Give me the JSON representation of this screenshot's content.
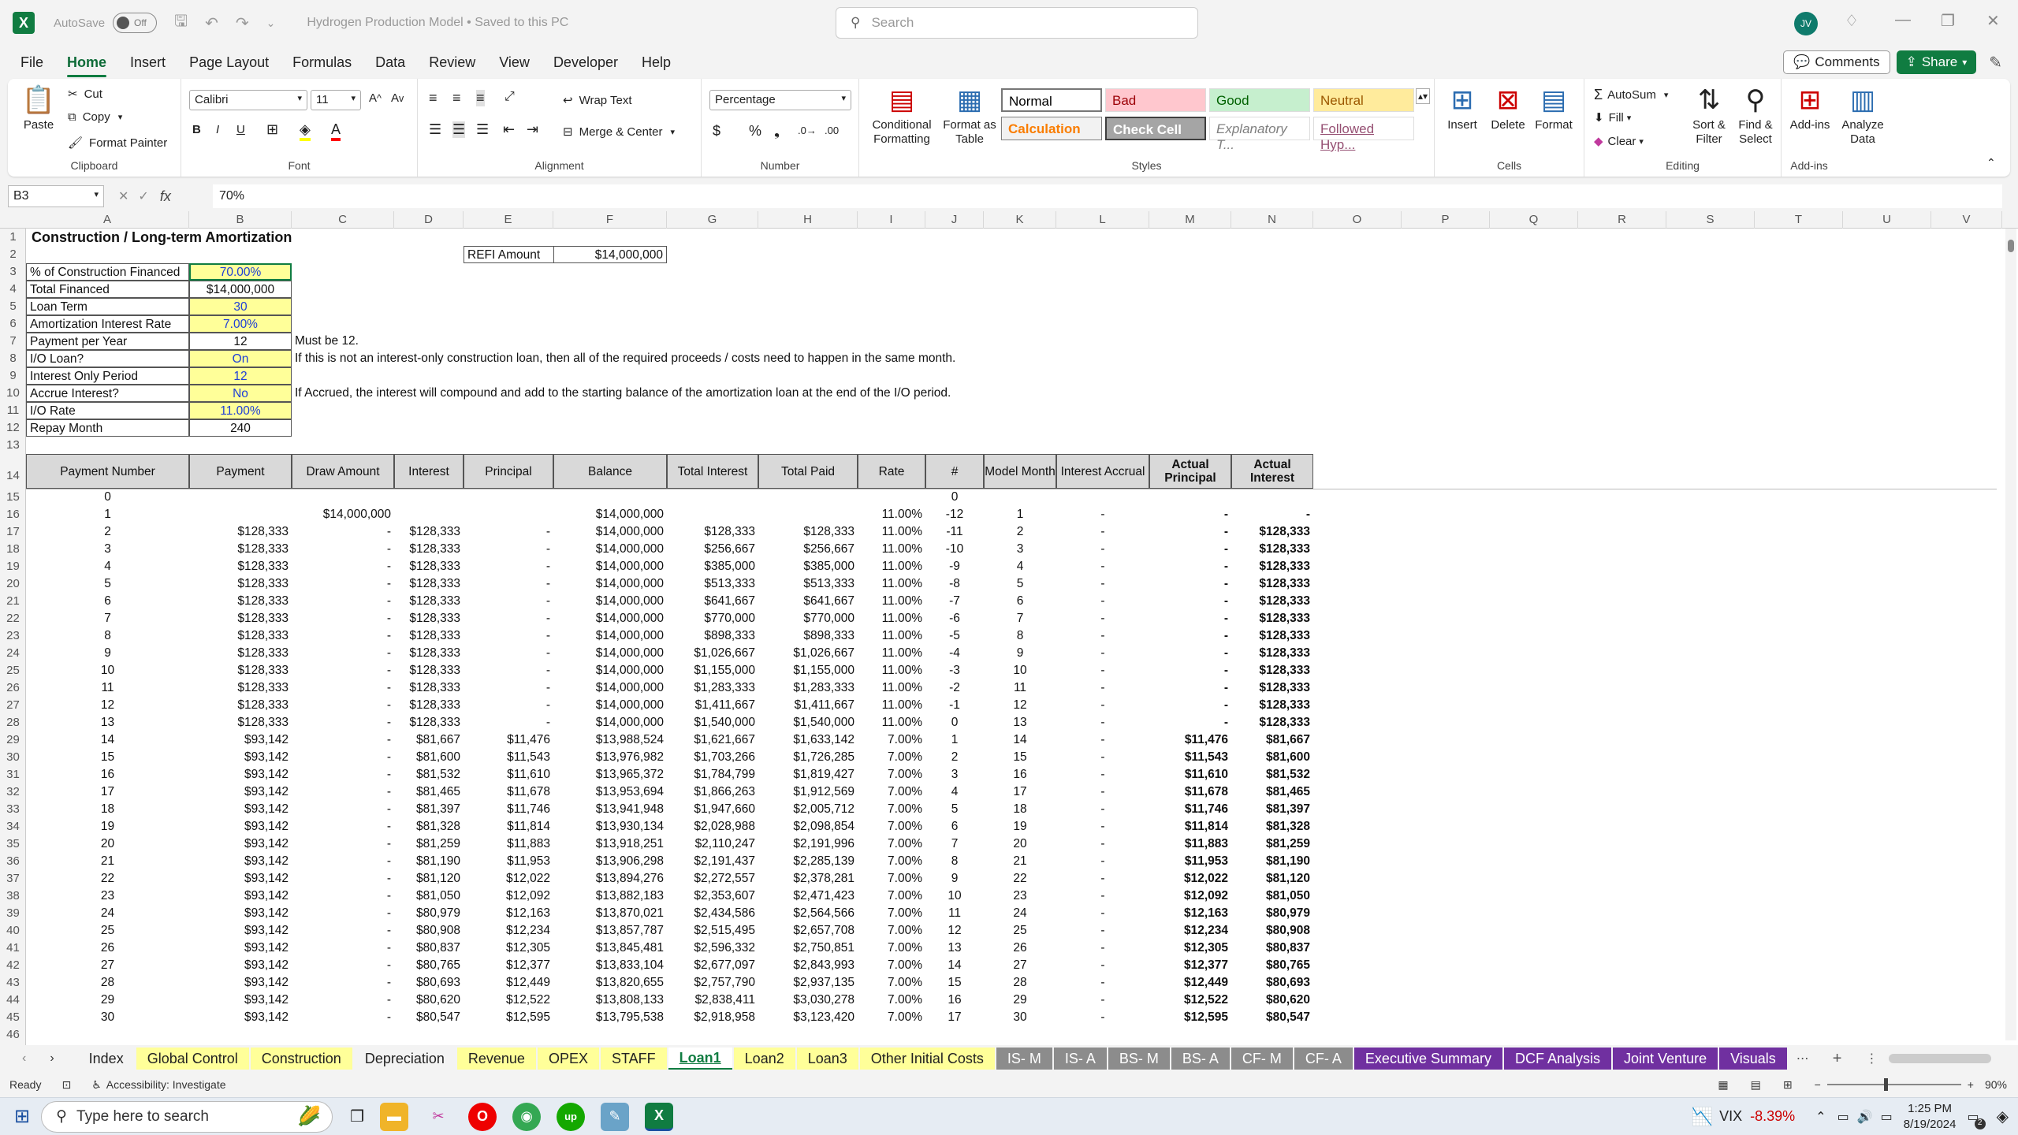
{
  "titlebar": {
    "autosave": "AutoSave",
    "autosave_state": "Off",
    "doc_title": "Hydrogen Production Model • Saved to this PC",
    "search_placeholder": "Search",
    "avatar": "JV"
  },
  "menu": [
    "File",
    "Home",
    "Insert",
    "Page Layout",
    "Formulas",
    "Data",
    "Review",
    "View",
    "Developer",
    "Help"
  ],
  "menu_active": "Home",
  "menu_right": {
    "comments": "Comments",
    "share": "Share"
  },
  "ribbon": {
    "clipboard": {
      "label": "Clipboard",
      "paste": "Paste",
      "cut": "Cut",
      "copy": "Copy",
      "format_painter": "Format Painter"
    },
    "font": {
      "label": "Font",
      "family": "Calibri",
      "size": "11"
    },
    "alignment": {
      "label": "Alignment",
      "wrap": "Wrap Text",
      "merge": "Merge & Center"
    },
    "number": {
      "label": "Number",
      "format": "Percentage"
    },
    "styles": {
      "label": "Styles",
      "conditional": "Conditional Formatting",
      "table": "Format as Table",
      "cells": [
        {
          "name": "Normal",
          "bg": "#ffffff",
          "fg": "#000000"
        },
        {
          "name": "Bad",
          "bg": "#ffc7ce",
          "fg": "#9c0006"
        },
        {
          "name": "Good",
          "bg": "#c6efce",
          "fg": "#006100"
        },
        {
          "name": "Neutral",
          "bg": "#ffeb9c",
          "fg": "#9c5700"
        },
        {
          "name": "Calculation",
          "bg": "#f2f2f2",
          "fg": "#fa7d00"
        },
        {
          "name": "Check Cell",
          "bg": "#a5a5a5",
          "fg": "#ffffff"
        },
        {
          "name": "Explanatory T...",
          "bg": "#ffffff",
          "fg": "#7f7f7f"
        },
        {
          "name": "Followed Hyp...",
          "bg": "#ffffff",
          "fg": "#954f72"
        }
      ]
    },
    "cells": {
      "label": "Cells",
      "insert": "Insert",
      "delete": "Delete",
      "format": "Format"
    },
    "editing": {
      "label": "Editing",
      "autosum": "AutoSum",
      "fill": "Fill",
      "clear": "Clear",
      "sort": "Sort & Filter",
      "find": "Find & Select"
    },
    "addins": {
      "label": "Add-ins",
      "addins": "Add-ins",
      "analyze": "Analyze Data"
    }
  },
  "formula": {
    "namebox": "B3",
    "value": "70%"
  },
  "columns": [
    "A",
    "B",
    "C",
    "D",
    "E",
    "F",
    "G",
    "H",
    "I",
    "J",
    "K",
    "L",
    "M",
    "N",
    "O",
    "P",
    "Q",
    "R",
    "S",
    "T",
    "U",
    "V"
  ],
  "sheet": {
    "title": "Construction / Long-term Amortization",
    "refi_label": "REFI Amount",
    "refi_value": "$14,000,000",
    "inputs": [
      {
        "label": "% of Construction Financed",
        "value": "70.00%",
        "blue": true,
        "yellow": true,
        "note": ""
      },
      {
        "label": "Total Financed",
        "value": "$14,000,000",
        "blue": false,
        "yellow": false,
        "note": ""
      },
      {
        "label": "Loan Term",
        "value": "30",
        "blue": true,
        "yellow": true,
        "note": ""
      },
      {
        "label": "Amortization Interest Rate",
        "value": "7.00%",
        "blue": true,
        "yellow": true,
        "note": ""
      },
      {
        "label": "Payment per Year",
        "value": "12",
        "blue": false,
        "yellow": false,
        "note": "Must be 12."
      },
      {
        "label": "I/O Loan?",
        "value": "On",
        "blue": true,
        "yellow": true,
        "note": "If this is not an interest-only construction loan, then all of the required proceeds / costs need to happen in the same month."
      },
      {
        "label": "Interest Only Period",
        "value": "12",
        "blue": true,
        "yellow": true,
        "note": ""
      },
      {
        "label": "Accrue Interest?",
        "value": "No",
        "blue": true,
        "yellow": true,
        "note": " If Accrued, the interest will compound and add to the starting balance of the amortization loan at the end of the I/O period."
      },
      {
        "label": "I/O Rate",
        "value": "11.00%",
        "blue": true,
        "yellow": true,
        "note": ""
      },
      {
        "label": "Repay Month",
        "value": "240",
        "blue": false,
        "yellow": false,
        "note": ""
      }
    ],
    "headers": [
      "Payment Number",
      "Payment",
      "Draw Amount",
      "Interest",
      "Principal",
      "Balance",
      "Total Interest",
      "Total Paid",
      "Rate",
      "#",
      "Model Month",
      "Interest Accrual",
      "Actual Principal",
      "Actual Interest"
    ],
    "rows": [
      [
        "0",
        "",
        "",
        "",
        "",
        "",
        "",
        "",
        "",
        "0",
        "",
        "",
        "",
        ""
      ],
      [
        "1",
        "",
        "$14,000,000",
        "",
        "",
        "$14,000,000",
        "",
        "",
        "11.00%",
        "-12",
        "1",
        "-",
        "-",
        "-"
      ],
      [
        "2",
        "$128,333",
        "-",
        "$128,333",
        "-",
        "$14,000,000",
        "$128,333",
        "$128,333",
        "11.00%",
        "-11",
        "2",
        "-",
        "-",
        "$128,333"
      ],
      [
        "3",
        "$128,333",
        "-",
        "$128,333",
        "-",
        "$14,000,000",
        "$256,667",
        "$256,667",
        "11.00%",
        "-10",
        "3",
        "-",
        "-",
        "$128,333"
      ],
      [
        "4",
        "$128,333",
        "-",
        "$128,333",
        "-",
        "$14,000,000",
        "$385,000",
        "$385,000",
        "11.00%",
        "-9",
        "4",
        "-",
        "-",
        "$128,333"
      ],
      [
        "5",
        "$128,333",
        "-",
        "$128,333",
        "-",
        "$14,000,000",
        "$513,333",
        "$513,333",
        "11.00%",
        "-8",
        "5",
        "-",
        "-",
        "$128,333"
      ],
      [
        "6",
        "$128,333",
        "-",
        "$128,333",
        "-",
        "$14,000,000",
        "$641,667",
        "$641,667",
        "11.00%",
        "-7",
        "6",
        "-",
        "-",
        "$128,333"
      ],
      [
        "7",
        "$128,333",
        "-",
        "$128,333",
        "-",
        "$14,000,000",
        "$770,000",
        "$770,000",
        "11.00%",
        "-6",
        "7",
        "-",
        "-",
        "$128,333"
      ],
      [
        "8",
        "$128,333",
        "-",
        "$128,333",
        "-",
        "$14,000,000",
        "$898,333",
        "$898,333",
        "11.00%",
        "-5",
        "8",
        "-",
        "-",
        "$128,333"
      ],
      [
        "9",
        "$128,333",
        "-",
        "$128,333",
        "-",
        "$14,000,000",
        "$1,026,667",
        "$1,026,667",
        "11.00%",
        "-4",
        "9",
        "-",
        "-",
        "$128,333"
      ],
      [
        "10",
        "$128,333",
        "-",
        "$128,333",
        "-",
        "$14,000,000",
        "$1,155,000",
        "$1,155,000",
        "11.00%",
        "-3",
        "10",
        "-",
        "-",
        "$128,333"
      ],
      [
        "11",
        "$128,333",
        "-",
        "$128,333",
        "-",
        "$14,000,000",
        "$1,283,333",
        "$1,283,333",
        "11.00%",
        "-2",
        "11",
        "-",
        "-",
        "$128,333"
      ],
      [
        "12",
        "$128,333",
        "-",
        "$128,333",
        "-",
        "$14,000,000",
        "$1,411,667",
        "$1,411,667",
        "11.00%",
        "-1",
        "12",
        "-",
        "-",
        "$128,333"
      ],
      [
        "13",
        "$128,333",
        "-",
        "$128,333",
        "-",
        "$14,000,000",
        "$1,540,000",
        "$1,540,000",
        "11.00%",
        "0",
        "13",
        "-",
        "-",
        "$128,333"
      ],
      [
        "14",
        "$93,142",
        "-",
        "$81,667",
        "$11,476",
        "$13,988,524",
        "$1,621,667",
        "$1,633,142",
        "7.00%",
        "1",
        "14",
        "-",
        "$11,476",
        "$81,667"
      ],
      [
        "15",
        "$93,142",
        "-",
        "$81,600",
        "$11,543",
        "$13,976,982",
        "$1,703,266",
        "$1,726,285",
        "7.00%",
        "2",
        "15",
        "-",
        "$11,543",
        "$81,600"
      ],
      [
        "16",
        "$93,142",
        "-",
        "$81,532",
        "$11,610",
        "$13,965,372",
        "$1,784,799",
        "$1,819,427",
        "7.00%",
        "3",
        "16",
        "-",
        "$11,610",
        "$81,532"
      ],
      [
        "17",
        "$93,142",
        "-",
        "$81,465",
        "$11,678",
        "$13,953,694",
        "$1,866,263",
        "$1,912,569",
        "7.00%",
        "4",
        "17",
        "-",
        "$11,678",
        "$81,465"
      ],
      [
        "18",
        "$93,142",
        "-",
        "$81,397",
        "$11,746",
        "$13,941,948",
        "$1,947,660",
        "$2,005,712",
        "7.00%",
        "5",
        "18",
        "-",
        "$11,746",
        "$81,397"
      ],
      [
        "19",
        "$93,142",
        "-",
        "$81,328",
        "$11,814",
        "$13,930,134",
        "$2,028,988",
        "$2,098,854",
        "7.00%",
        "6",
        "19",
        "-",
        "$11,814",
        "$81,328"
      ],
      [
        "20",
        "$93,142",
        "-",
        "$81,259",
        "$11,883",
        "$13,918,251",
        "$2,110,247",
        "$2,191,996",
        "7.00%",
        "7",
        "20",
        "-",
        "$11,883",
        "$81,259"
      ],
      [
        "21",
        "$93,142",
        "-",
        "$81,190",
        "$11,953",
        "$13,906,298",
        "$2,191,437",
        "$2,285,139",
        "7.00%",
        "8",
        "21",
        "-",
        "$11,953",
        "$81,190"
      ],
      [
        "22",
        "$93,142",
        "-",
        "$81,120",
        "$12,022",
        "$13,894,276",
        "$2,272,557",
        "$2,378,281",
        "7.00%",
        "9",
        "22",
        "-",
        "$12,022",
        "$81,120"
      ],
      [
        "23",
        "$93,142",
        "-",
        "$81,050",
        "$12,092",
        "$13,882,183",
        "$2,353,607",
        "$2,471,423",
        "7.00%",
        "10",
        "23",
        "-",
        "$12,092",
        "$81,050"
      ],
      [
        "24",
        "$93,142",
        "-",
        "$80,979",
        "$12,163",
        "$13,870,021",
        "$2,434,586",
        "$2,564,566",
        "7.00%",
        "11",
        "24",
        "-",
        "$12,163",
        "$80,979"
      ],
      [
        "25",
        "$93,142",
        "-",
        "$80,908",
        "$12,234",
        "$13,857,787",
        "$2,515,495",
        "$2,657,708",
        "7.00%",
        "12",
        "25",
        "-",
        "$12,234",
        "$80,908"
      ],
      [
        "26",
        "$93,142",
        "-",
        "$80,837",
        "$12,305",
        "$13,845,481",
        "$2,596,332",
        "$2,750,851",
        "7.00%",
        "13",
        "26",
        "-",
        "$12,305",
        "$80,837"
      ],
      [
        "27",
        "$93,142",
        "-",
        "$80,765",
        "$12,377",
        "$13,833,104",
        "$2,677,097",
        "$2,843,993",
        "7.00%",
        "14",
        "27",
        "-",
        "$12,377",
        "$80,765"
      ],
      [
        "28",
        "$93,142",
        "-",
        "$80,693",
        "$12,449",
        "$13,820,655",
        "$2,757,790",
        "$2,937,135",
        "7.00%",
        "15",
        "28",
        "-",
        "$12,449",
        "$80,693"
      ],
      [
        "29",
        "$93,142",
        "-",
        "$80,620",
        "$12,522",
        "$13,808,133",
        "$2,838,411",
        "$3,030,278",
        "7.00%",
        "16",
        "29",
        "-",
        "$12,522",
        "$80,620"
      ],
      [
        "30",
        "$93,142",
        "-",
        "$80,547",
        "$12,595",
        "$13,795,538",
        "$2,918,958",
        "$3,123,420",
        "7.00%",
        "17",
        "30",
        "-",
        "$12,595",
        "$80,547"
      ]
    ]
  },
  "tabs": [
    {
      "name": "Index",
      "bg": "#f3f3f3",
      "fg": "#222"
    },
    {
      "name": "Global Control",
      "bg": "#ffff99",
      "fg": "#222"
    },
    {
      "name": "Construction",
      "bg": "#ffff99",
      "fg": "#222"
    },
    {
      "name": "Depreciation",
      "bg": "#f3f3f3",
      "fg": "#222"
    },
    {
      "name": "Revenue",
      "bg": "#ffff99",
      "fg": "#222"
    },
    {
      "name": "OPEX",
      "bg": "#ffff99",
      "fg": "#222"
    },
    {
      "name": "STAFF",
      "bg": "#ffff99",
      "fg": "#222"
    },
    {
      "name": "Loan1",
      "bg": "#ffffff",
      "fg": "#107c41",
      "active": true
    },
    {
      "name": "Loan2",
      "bg": "#ffff99",
      "fg": "#222"
    },
    {
      "name": "Loan3",
      "bg": "#ffff99",
      "fg": "#222"
    },
    {
      "name": "Other Initial Costs",
      "bg": "#ffff99",
      "fg": "#222"
    },
    {
      "name": "IS- M",
      "bg": "#8c8c8c",
      "fg": "#fff"
    },
    {
      "name": "IS- A",
      "bg": "#8c8c8c",
      "fg": "#fff"
    },
    {
      "name": "BS- M",
      "bg": "#8c8c8c",
      "fg": "#fff"
    },
    {
      "name": "BS- A",
      "bg": "#8c8c8c",
      "fg": "#fff"
    },
    {
      "name": "CF- M",
      "bg": "#8c8c8c",
      "fg": "#fff"
    },
    {
      "name": "CF- A",
      "bg": "#8c8c8c",
      "fg": "#fff"
    },
    {
      "name": "Executive Summary",
      "bg": "#7030a0",
      "fg": "#fff"
    },
    {
      "name": "DCF Analysis",
      "bg": "#7030a0",
      "fg": "#fff"
    },
    {
      "name": "Joint Venture",
      "bg": "#7030a0",
      "fg": "#fff"
    },
    {
      "name": "Visuals",
      "bg": "#7030a0",
      "fg": "#fff"
    }
  ],
  "status": {
    "ready": "Ready",
    "accessibility": "Accessibility: Investigate",
    "zoom": "90%"
  },
  "taskbar": {
    "search": "Type here to search",
    "vix": "VIX",
    "vix_change": "-8.39%",
    "time": "1:25 PM",
    "date": "8/19/2024",
    "badge": "2"
  }
}
